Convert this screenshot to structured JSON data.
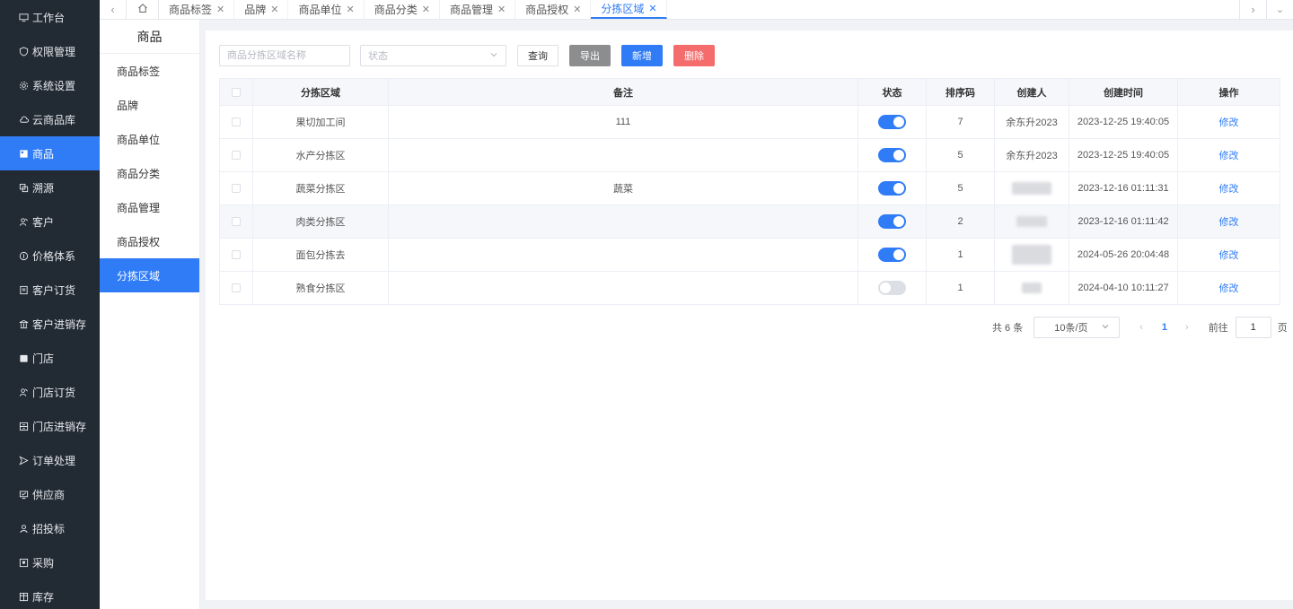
{
  "colors": {
    "primary": "#2f7cf6",
    "sidebar_bg": "#222a33",
    "danger": "#f56c6c",
    "export_gray": "#8c8d8f"
  },
  "sidebar": {
    "items": [
      {
        "label": "工作台",
        "icon": "monitor-icon"
      },
      {
        "label": "权限管理",
        "icon": "shield-icon"
      },
      {
        "label": "系统设置",
        "icon": "gear-icon"
      },
      {
        "label": "云商品库",
        "icon": "cloud-icon"
      },
      {
        "label": "商品",
        "icon": "goods-icon",
        "active": true
      },
      {
        "label": "溯源",
        "icon": "trace-icon"
      },
      {
        "label": "客户",
        "icon": "customer-icon"
      },
      {
        "label": "价格体系",
        "icon": "price-icon"
      },
      {
        "label": "客户订货",
        "icon": "order-doc-icon"
      },
      {
        "label": "客户进销存",
        "icon": "bank-icon"
      },
      {
        "label": "门店",
        "icon": "store-icon"
      },
      {
        "label": "门店订货",
        "icon": "store-order-icon"
      },
      {
        "label": "门店进销存",
        "icon": "inventory-icon"
      },
      {
        "label": "订单处理",
        "icon": "send-icon"
      },
      {
        "label": "供应商",
        "icon": "supplier-icon"
      },
      {
        "label": "招投标",
        "icon": "user-icon"
      },
      {
        "label": "采购",
        "icon": "purchase-icon"
      },
      {
        "label": "库存",
        "icon": "warehouse-icon"
      }
    ]
  },
  "tabs": [
    {
      "label": "商品标签"
    },
    {
      "label": "品牌"
    },
    {
      "label": "商品单位"
    },
    {
      "label": "商品分类"
    },
    {
      "label": "商品管理"
    },
    {
      "label": "商品授权"
    },
    {
      "label": "分拣区域",
      "active": true
    }
  ],
  "submenu": {
    "title": "商品",
    "items": [
      "商品标签",
      "品牌",
      "商品单位",
      "商品分类",
      "商品管理",
      "商品授权",
      "分拣区域"
    ],
    "active_index": 6
  },
  "filters": {
    "name_placeholder": "商品分拣区域名称",
    "status_placeholder": "状态"
  },
  "buttons": {
    "query": "查询",
    "export": "导出",
    "add": "新增",
    "delete": "删除"
  },
  "table": {
    "columns": [
      "分拣区域",
      "备注",
      "状态",
      "排序码",
      "创建人",
      "创建时间",
      "操作"
    ],
    "rows": [
      {
        "name": "果切加工间",
        "note": "111",
        "status": true,
        "sort": "7",
        "creator": "余东升2023",
        "time": "2023-12-25 19:40:05",
        "op": "修改"
      },
      {
        "name": "水产分拣区",
        "note": "",
        "status": true,
        "sort": "5",
        "creator": "余东升2023",
        "time": "2023-12-25 19:40:05",
        "op": "修改"
      },
      {
        "name": "蔬菜分拣区",
        "note": "蔬菜",
        "status": true,
        "sort": "5",
        "creator": "",
        "time": "2023-12-16 01:11:31",
        "op": "修改"
      },
      {
        "name": "肉类分拣区",
        "note": "",
        "status": true,
        "sort": "2",
        "creator": "",
        "time": "2023-12-16 01:11:42",
        "op": "修改"
      },
      {
        "name": "面包分拣去",
        "note": "",
        "status": true,
        "sort": "1",
        "creator": "",
        "time": "2024-05-26 20:04:48",
        "op": "修改"
      },
      {
        "name": "熟食分拣区",
        "note": "",
        "status": false,
        "sort": "1",
        "creator": "",
        "time": "2024-04-10 10:11:27",
        "op": "修改"
      }
    ]
  },
  "pagination": {
    "total": "共 6 条",
    "page_size": "10条/页",
    "current": "1",
    "goto_label": "前往",
    "goto_value": "1",
    "page_suffix": "页"
  }
}
